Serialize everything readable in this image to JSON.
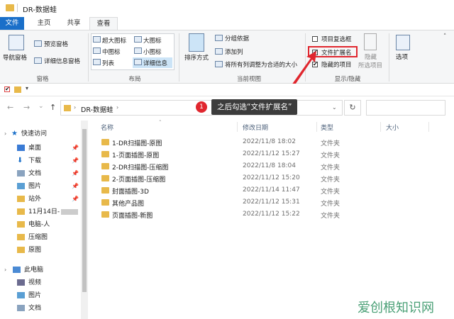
{
  "window": {
    "title": "DR-数据蛙"
  },
  "tabs": [
    {
      "label": "文件"
    },
    {
      "label": "主页"
    },
    {
      "label": "共享"
    },
    {
      "label": "查看"
    }
  ],
  "ribbon": {
    "panes": {
      "nav_pane": "导航窗格",
      "preview_pane": "预览窗格",
      "details_pane": "详细信息窗格",
      "group_label": "窗格"
    },
    "layout": {
      "items": [
        "超大图标",
        "大图标",
        "中图标",
        "小图标",
        "列表",
        "详细信息"
      ],
      "group_label": "布局"
    },
    "current_view": {
      "sort_by": "排序方式",
      "group_by": "分组依据",
      "add_column": "添加列",
      "fit_columns": "将所有列调整为合适的大小",
      "group_label": "当前视图"
    },
    "show_hide": {
      "item_checkboxes": "项目复选框",
      "file_extensions": "文件扩展名",
      "hidden_items": "隐藏的项目",
      "hide_selected_1": "隐藏",
      "hide_selected_2": "所选项目",
      "options": "选项",
      "group_label": "显示/隐藏",
      "item_checkboxes_checked": false,
      "file_extensions_checked": true,
      "hidden_items_checked": true
    }
  },
  "address": {
    "path": "DR-数据蛙",
    "search_placeholder": ""
  },
  "callout": {
    "number": "1",
    "text": "之后勾选“文件扩展名”"
  },
  "nav": {
    "quick_access": "快速访问",
    "items": [
      {
        "label": "桌面",
        "pinned": true
      },
      {
        "label": "下载",
        "pinned": true
      },
      {
        "label": "文档",
        "pinned": true
      },
      {
        "label": "图片",
        "pinned": true
      },
      {
        "label": "站外",
        "pinned": true
      },
      {
        "label": "11月14日-",
        "pinned": false
      },
      {
        "label": "电脑-人",
        "pinned": false
      },
      {
        "label": "压缩图",
        "pinned": false
      },
      {
        "label": "原图",
        "pinned": false
      }
    ],
    "this_pc": "此电脑",
    "pc_items": [
      "视频",
      "图片",
      "文档"
    ]
  },
  "columns": {
    "name": "名称",
    "modified": "修改日期",
    "type": "类型",
    "size": "大小"
  },
  "files": [
    {
      "name": "1-DR扫描图-原图",
      "modified": "2022/11/8 18:02",
      "type": "文件夹"
    },
    {
      "name": "1-页面插图-原图",
      "modified": "2022/11/12 15:27",
      "type": "文件夹"
    },
    {
      "name": "2-DR扫描图-压缩图",
      "modified": "2022/11/8 18:04",
      "type": "文件夹"
    },
    {
      "name": "2-页面插图-压缩图",
      "modified": "2022/11/12 15:20",
      "type": "文件夹"
    },
    {
      "name": "封面插图-3D",
      "modified": "2022/11/14 11:47",
      "type": "文件夹"
    },
    {
      "name": "其他产品图",
      "modified": "2022/11/12 15:31",
      "type": "文件夹"
    },
    {
      "name": "页面插图-新图",
      "modified": "2022/11/12 15:22",
      "type": "文件夹"
    }
  ],
  "watermark": "爱创根知识网",
  "colors": {
    "accent": "#1a6fc9",
    "callout_red": "#e0262e",
    "folder": "#e8b94a"
  }
}
